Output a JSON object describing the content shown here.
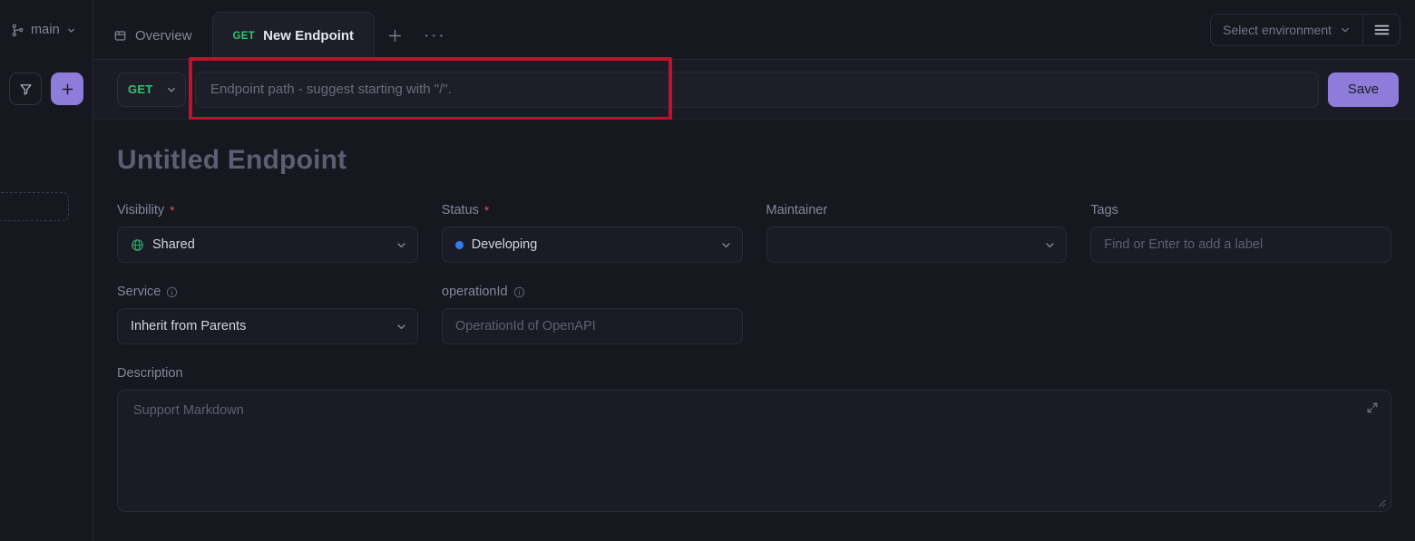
{
  "sidebar": {
    "branch": {
      "name": "main",
      "icon": "git-branch-icon",
      "chevron": "chevron-down-icon"
    },
    "tools": {
      "filter_icon": "filter-icon",
      "add_label": "+",
      "add_icon": "plus-icon"
    }
  },
  "tabs": {
    "items": [
      {
        "label": "Overview",
        "icon": "box-icon",
        "method": "",
        "active": false
      },
      {
        "label": "New Endpoint",
        "icon": "",
        "method": "GET",
        "active": true
      }
    ],
    "new_tab_label": "+",
    "more_label": "···"
  },
  "topbar": {
    "environment_label": "Select environment",
    "environment_chevron": "chevron-down-icon",
    "menu_icon": "hamburger-menu-icon"
  },
  "urlbar": {
    "method": "GET",
    "method_chevron": "chevron-down-icon",
    "path_placeholder": "Endpoint path - suggest starting with \"/\".",
    "path_value": "",
    "save_label": "Save"
  },
  "annotation": {
    "highlight_color": "#c1112b",
    "target": "endpoint-path-input"
  },
  "form": {
    "title": "Untitled Endpoint",
    "visibility": {
      "label": "Visibility",
      "required": "*",
      "value": "Shared",
      "icon": "globe-icon",
      "icon_color": "#2fa86a"
    },
    "status": {
      "label": "Status",
      "required": "*",
      "value": "Developing",
      "dot_color": "#2f7ef0"
    },
    "maintainer": {
      "label": "Maintainer",
      "value": ""
    },
    "tags": {
      "label": "Tags",
      "placeholder": "Find or Enter to add a label",
      "value": ""
    },
    "service": {
      "label": "Service",
      "info_icon": "info-icon",
      "value": "Inherit from Parents"
    },
    "operation_id": {
      "label": "operationId",
      "info_icon": "info-icon",
      "placeholder": "OperationId of OpenAPI",
      "value": ""
    },
    "description": {
      "label": "Description",
      "placeholder": "Support Markdown",
      "value": "",
      "expand_icon": "expand-icon",
      "resize_icon": "resize-handle-icon"
    }
  },
  "theme": {
    "background": "#17171f",
    "panel": "#1b1b25",
    "accent": "#8e7cdb",
    "method_get": "#30c46f"
  }
}
